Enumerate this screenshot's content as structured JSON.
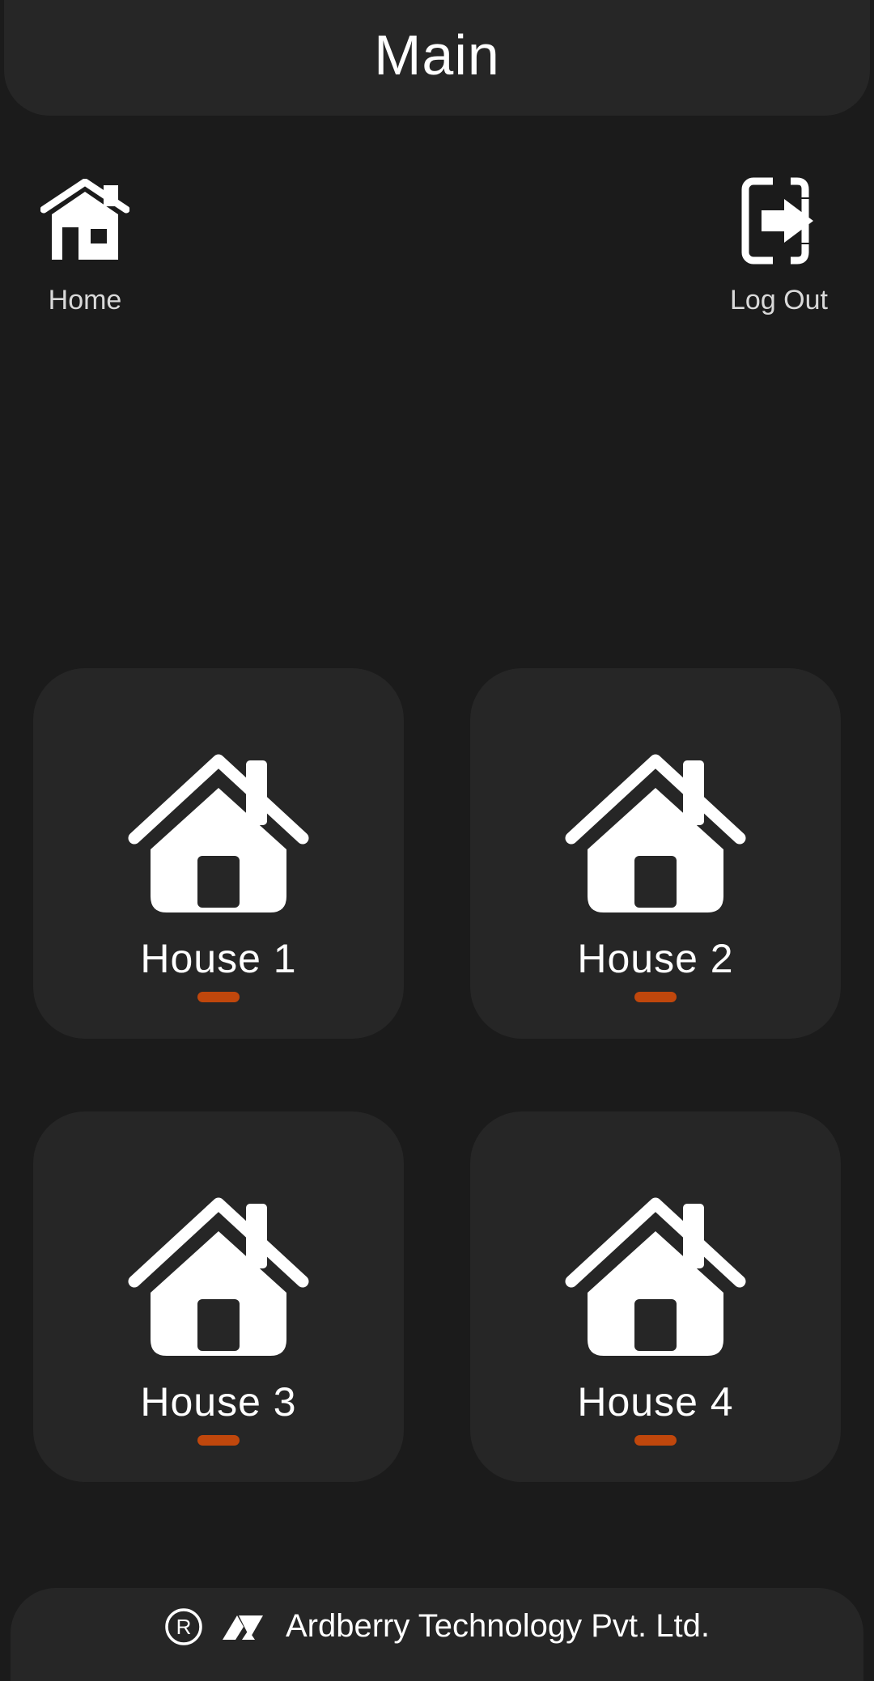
{
  "header": {
    "title": "Main"
  },
  "nav": {
    "home": {
      "label": "Home",
      "icon": "home-icon"
    },
    "logout": {
      "label": "Log Out",
      "icon": "logout-icon"
    }
  },
  "houses": [
    {
      "label": "House 1",
      "icon": "house-icon",
      "indicator_color": "#c0470c"
    },
    {
      "label": "House 2",
      "icon": "house-icon",
      "indicator_color": "#c0470c"
    },
    {
      "label": "House 3",
      "icon": "house-icon",
      "indicator_color": "#c0470c"
    },
    {
      "label": "House 4",
      "icon": "house-icon",
      "indicator_color": "#c0470c"
    }
  ],
  "footer": {
    "company": "Ardberry Technology Pvt. Ltd.",
    "registered_icon": "registered-icon",
    "logo_icon": "brand-logo-icon"
  },
  "colors": {
    "background": "#1b1b1b",
    "panel": "#262626",
    "accent": "#c0470c",
    "text": "#ffffff"
  }
}
